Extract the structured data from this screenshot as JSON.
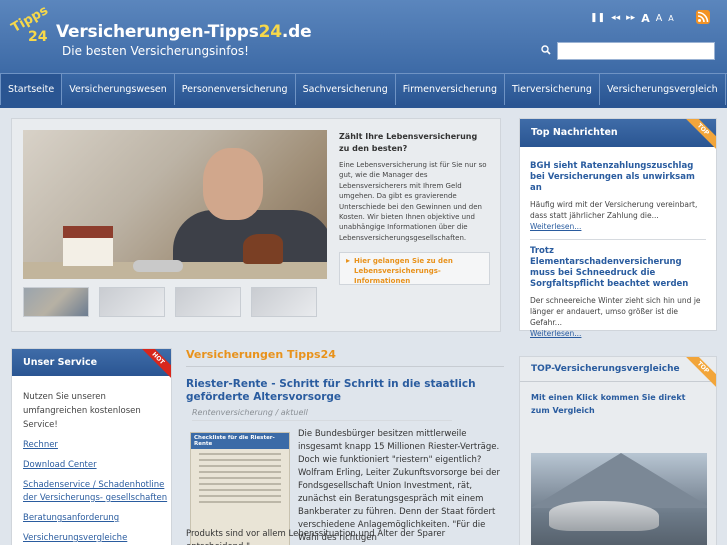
{
  "header": {
    "logo_badge_top": "Tipps",
    "logo_badge_bottom": "24",
    "site_name_main": "Versicherungen-Tipps",
    "site_name_num": "24",
    "site_name_tld": ".de",
    "tagline": "Die besten Versicherungsinfos!",
    "tools": [
      "❚❚",
      "◂◂",
      "▸▸",
      "A",
      "A",
      "A"
    ],
    "rss_label": "RSS",
    "search_placeholder": ""
  },
  "nav": {
    "items": [
      "Startseite",
      "Versicherungswesen",
      "Personenversicherung",
      "Sachversicherung",
      "Firmenversicherung",
      "Tierversicherung",
      "Versicherungsvergleich"
    ]
  },
  "hero": {
    "title": "Zählt Ihre Lebensversicherung zu den besten?",
    "text": "Eine Lebensversicherung ist für Sie nur so gut, wie die Manager des Lebensversicherers mit Ihrem Geld umgehen. Da gibt es gravierende Unterschiede bei den Gewinnen und den Kosten. Wir bieten Ihnen objektive und unabhängige Informationen über die Lebensversicherungsgesellschaften.",
    "link": "Hier gelangen Sie zu den Lebensversicherungs-Informationen"
  },
  "service": {
    "heading": "Unser Service",
    "badge": "HOT",
    "intro": "Nutzen Sie unseren umfangreichen kostenlosen Service!",
    "links": [
      "Rechner",
      "Download Center",
      "Schadenservice / Schadenhotline der Versicherungs- gesellschaften",
      "Beratungsanforderung",
      "Versicherungsvergleiche"
    ]
  },
  "main": {
    "title": "Versicherungen Tipps24",
    "article_title": "Riester-Rente - Schritt für Schritt in die staatlich geförderte Altersvorsorge",
    "article_category": "Rentenversicherung / aktuell",
    "image_heading": "Checkliste für die Riester-Rente",
    "article_text": "Die Bundesbürger besitzen mittlerweile insgesamt knapp 15 Millionen Riester-Verträge. Doch wie funktioniert \"riestern\" eigentlich? Wolfram Erling, Leiter Zukunftsvorsorge bei der Fondsgesellschaft Union Investment, rät, zunächst ein Beratungsgespräch mit einem Bankberater zu führen. Denn der Staat fördert verschiedene Anlagemöglichkeiten. \"Für die Wahl des richtigen",
    "article_text_full": "Produkts sind vor allem Lebenssituation und Alter der Sparer entscheidend.\""
  },
  "news": {
    "heading": "Top Nachrichten",
    "badge": "TOP",
    "items": [
      {
        "title": "BGH sieht Ratenzahlungszuschlag bei Versicherungen als unwirksam an",
        "text": "Häufig wird mit der Versicherung vereinbart, dass statt jährlicher Zahlung die...",
        "more": "Weiterlesen..."
      },
      {
        "title": "Trotz Elementarschadenversicherung muss bei Schneedruck die Sorgfaltspflicht beachtet werden",
        "text": "Der schneereiche Winter zieht sich hin und je länger er andauert, umso größer ist die Gefahr...",
        "more": "Weiterlesen..."
      }
    ]
  },
  "topvgl": {
    "heading": "TOP-Versicherungsvergleiche",
    "badge": "TOP",
    "text": "Mit einen Klick kommen Sie direkt zum Vergleich"
  }
}
